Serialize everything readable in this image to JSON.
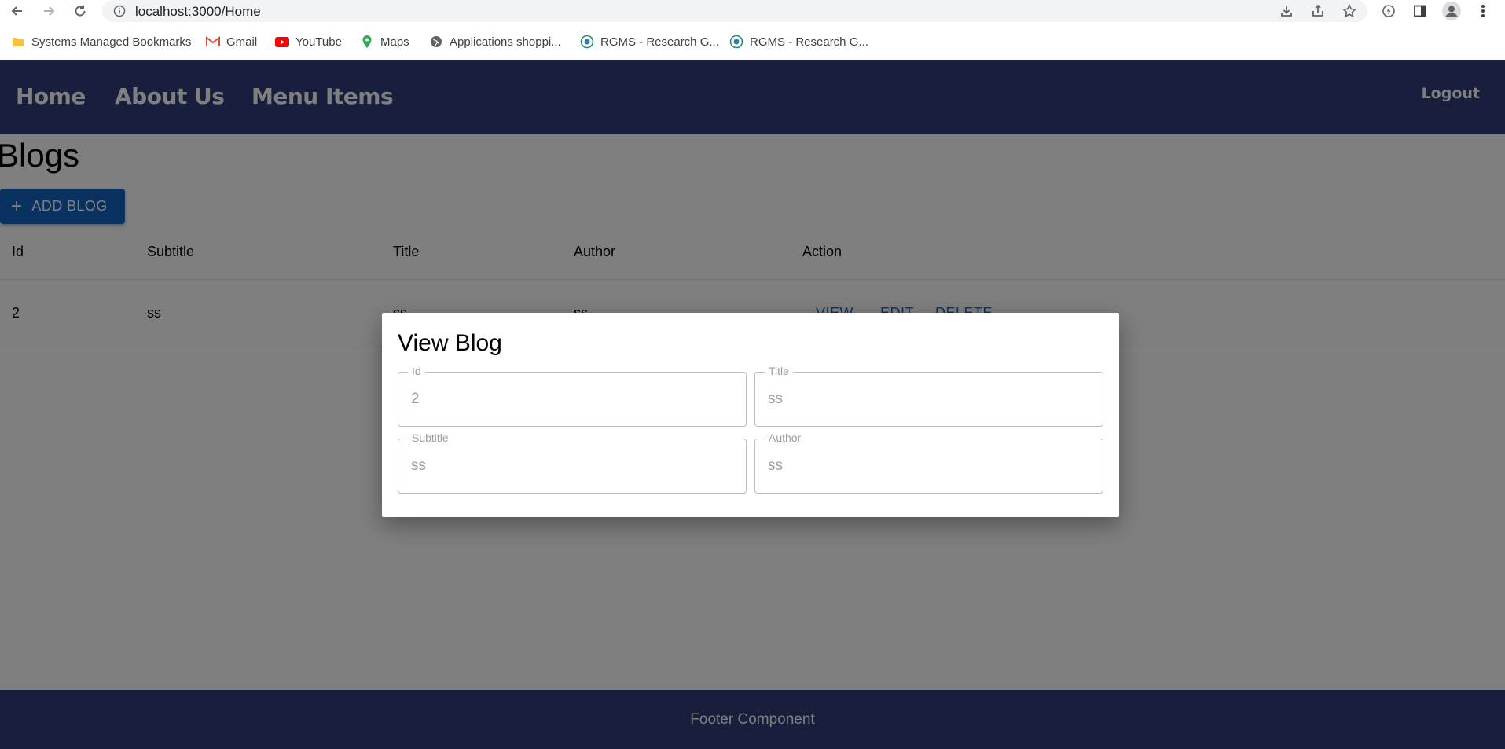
{
  "browser": {
    "url": "localhost:3000/Home",
    "bookmarks": [
      {
        "label": "Systems Managed Bookmarks",
        "icon": "folder-icon"
      },
      {
        "label": "Gmail",
        "icon": "gmail-icon"
      },
      {
        "label": "YouTube",
        "icon": "youtube-icon"
      },
      {
        "label": "Maps",
        "icon": "maps-icon"
      },
      {
        "label": "Applications shoppi...",
        "icon": "globe-icon"
      },
      {
        "label": "RGMS - Research G...",
        "icon": "rgms-icon"
      },
      {
        "label": "RGMS - Research G...",
        "icon": "rgms-icon"
      }
    ]
  },
  "navbar": {
    "links": [
      "Home",
      "About Us",
      "Menu Items"
    ],
    "logout": "Logout",
    "color": "#2e3f7a"
  },
  "page": {
    "title": "Blogs",
    "add_button": "ADD BLOG",
    "accent": "#1565c0"
  },
  "table": {
    "headers": [
      "Id",
      "Subtitle",
      "Title",
      "Author",
      "Action"
    ],
    "rows": [
      {
        "id": "2",
        "subtitle": "ss",
        "title": "ss",
        "author": "ss"
      }
    ],
    "actions": [
      "VIEW",
      "EDIT",
      "DELETE"
    ]
  },
  "dialog": {
    "title": "View Blog",
    "fields": {
      "id": {
        "label": "Id",
        "value": "2"
      },
      "title": {
        "label": "Title",
        "value": "ss"
      },
      "subtitle": {
        "label": "Subtitle",
        "value": "ss"
      },
      "author": {
        "label": "Author",
        "value": "ss"
      }
    }
  },
  "footer": {
    "text": "Footer Component"
  }
}
